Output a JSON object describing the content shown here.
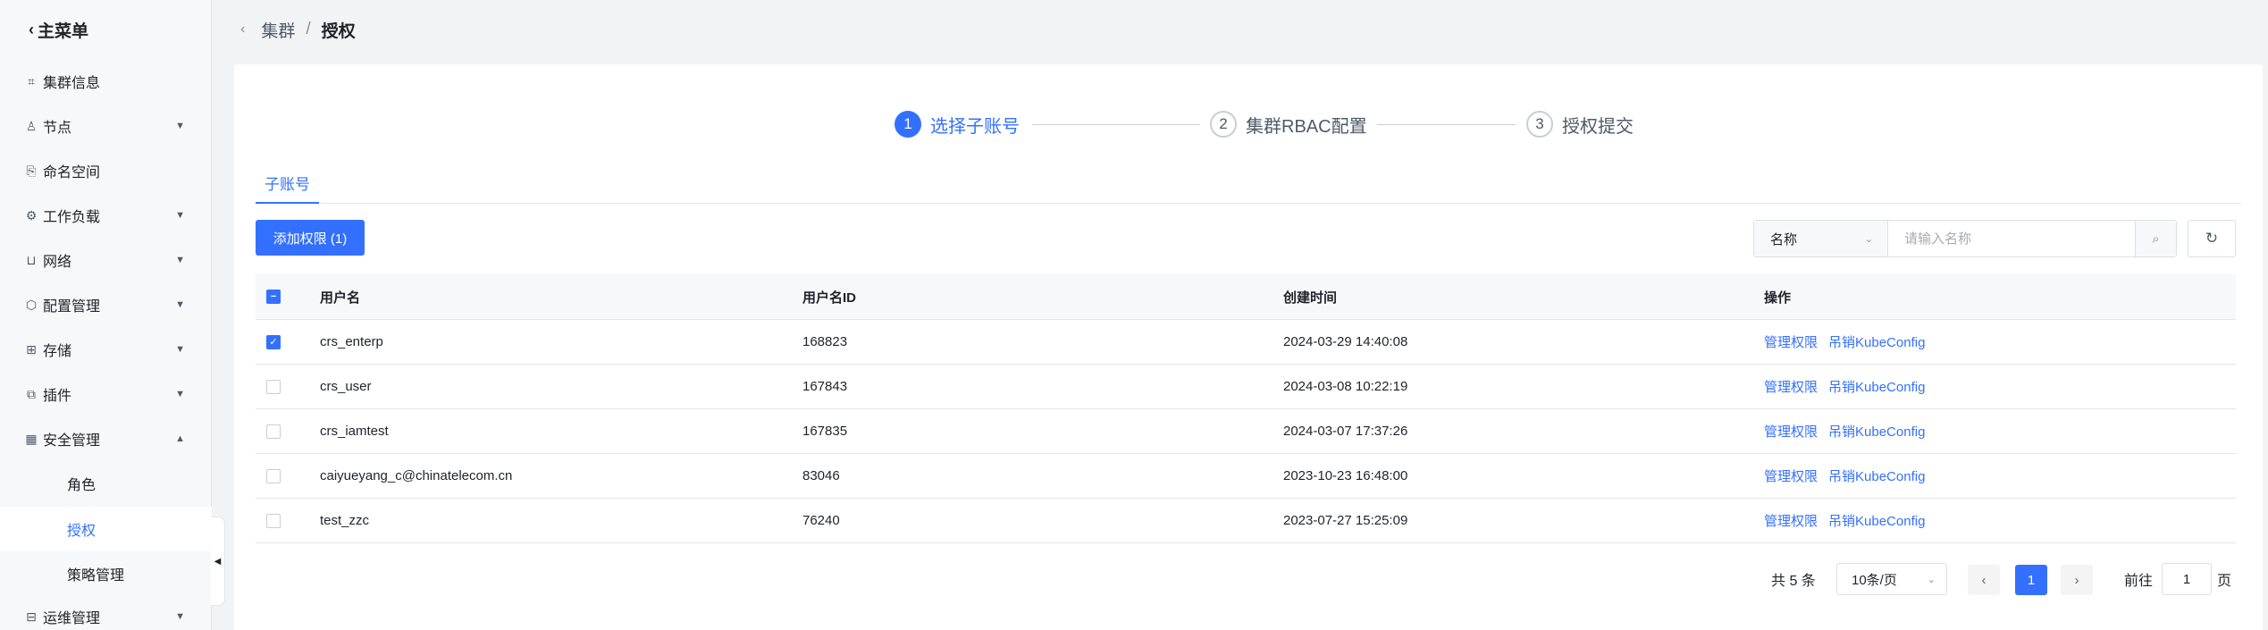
{
  "sidebar": {
    "title": "主菜单",
    "items": [
      {
        "label": "集群信息",
        "icon": "cluster-icon",
        "expandable": false
      },
      {
        "label": "节点",
        "icon": "node-icon",
        "expandable": true
      },
      {
        "label": "命名空间",
        "icon": "namespace-icon",
        "expandable": false
      },
      {
        "label": "工作负载",
        "icon": "workload-icon",
        "expandable": true
      },
      {
        "label": "网络",
        "icon": "network-icon",
        "expandable": true
      },
      {
        "label": "配置管理",
        "icon": "config-icon",
        "expandable": true
      },
      {
        "label": "存储",
        "icon": "storage-icon",
        "expandable": true
      },
      {
        "label": "插件",
        "icon": "plugin-icon",
        "expandable": true
      },
      {
        "label": "安全管理",
        "icon": "security-icon",
        "expandable": true,
        "expanded": true
      }
    ],
    "security_sub": [
      {
        "label": "角色",
        "active": false
      },
      {
        "label": "授权",
        "active": true
      },
      {
        "label": "策略管理",
        "active": false
      }
    ],
    "last_item": {
      "label": "运维管理",
      "icon": "ops-icon"
    }
  },
  "breadcrumb": {
    "parent": "集群",
    "separator": "/",
    "current": "授权"
  },
  "steps": [
    {
      "num": "1",
      "label": "选择子账号",
      "state": "active"
    },
    {
      "num": "2",
      "label": "集群RBAC配置",
      "state": "pending"
    },
    {
      "num": "3",
      "label": "授权提交",
      "state": "pending"
    }
  ],
  "tabs": {
    "active": "子账号"
  },
  "toolbar": {
    "add_button": "添加权限 (1)",
    "search_field": "名称",
    "search_placeholder": "请输入名称"
  },
  "table": {
    "columns": [
      "用户名",
      "用户名ID",
      "创建时间",
      "操作"
    ],
    "rows": [
      {
        "checked": true,
        "name": "crs_enterp",
        "id": "168823",
        "created": "2024-03-29 14:40:08",
        "op1": "管理权限",
        "op2": "吊销KubeConfig"
      },
      {
        "checked": false,
        "name": "crs_user",
        "id": "167843",
        "created": "2024-03-08 10:22:19",
        "op1": "管理权限",
        "op2": "吊销KubeConfig"
      },
      {
        "checked": false,
        "name": "crs_iamtest",
        "id": "167835",
        "created": "2024-03-07 17:37:26",
        "op1": "管理权限",
        "op2": "吊销KubeConfig"
      },
      {
        "checked": false,
        "name": "caiyueyang_c@chinatelecom.cn",
        "id": "83046",
        "created": "2023-10-23 16:48:00",
        "op1": "管理权限",
        "op2": "吊销KubeConfig"
      },
      {
        "checked": false,
        "name": "test_zzc",
        "id": "76240",
        "created": "2023-07-27 15:25:09",
        "op1": "管理权限",
        "op2": "吊销KubeConfig"
      }
    ]
  },
  "pagination": {
    "total": "共 5 条",
    "page_size": "10条/页",
    "current_page": "1",
    "goto_prefix": "前往",
    "goto_value": "1",
    "goto_suffix": "页"
  },
  "colors": {
    "accent": "#3370ff",
    "background": "#f2f3f5",
    "card": "#ffffff"
  }
}
